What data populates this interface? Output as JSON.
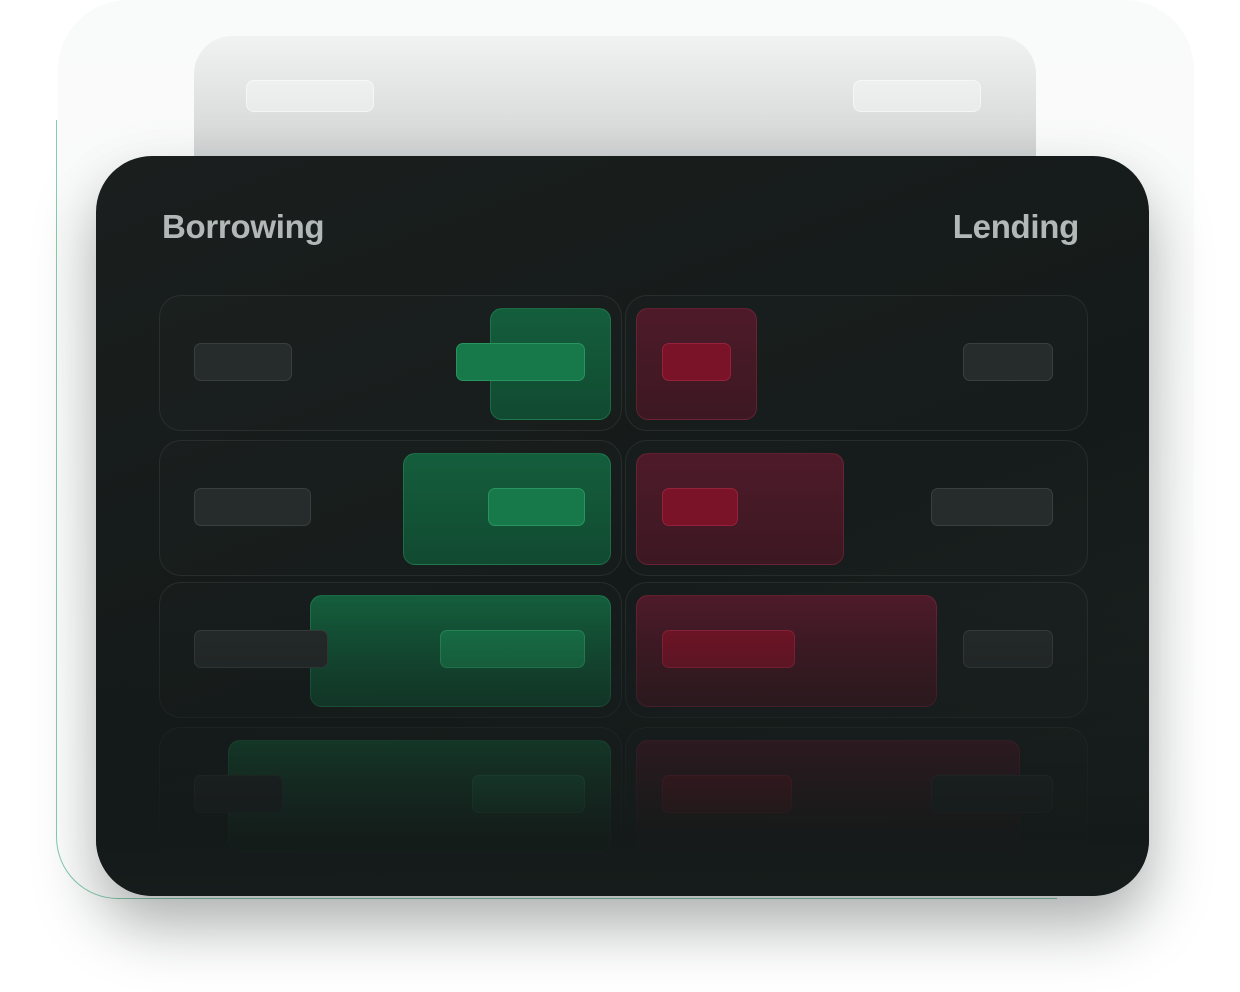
{
  "columns": {
    "left_title": "Borrowing",
    "right_title": "Lending"
  },
  "colors": {
    "borrowing_accent": "#17784a",
    "lending_accent": "#7a1328",
    "card_background": "#161c1b",
    "title_text": "#b2b8b7",
    "outline_accent": "#78c8a4"
  }
}
